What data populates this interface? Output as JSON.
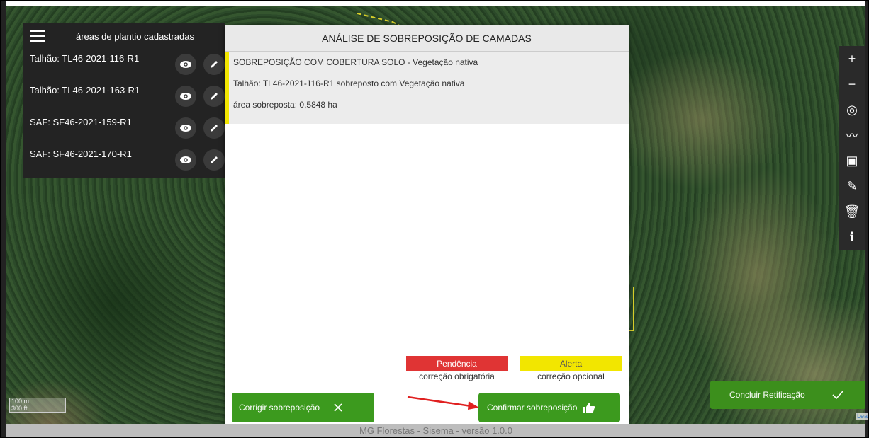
{
  "panel": {
    "title": "áreas de plantio cadastradas",
    "layers": [
      {
        "label": "Talhão: TL46-2021-116-R1"
      },
      {
        "label": "Talhão: TL46-2021-163-R1"
      },
      {
        "label": "SAF: SF46-2021-159-R1"
      },
      {
        "label": "SAF: SF46-2021-170-R1"
      }
    ],
    "icons": [
      "menu-icon",
      "eye-icon",
      "pencil-icon"
    ]
  },
  "modal": {
    "title": "ANÁLISE DE SOBREPOSIÇÃO DE CAMADAS",
    "overlap": {
      "heading": "SOBREPOSIÇÃO COM COBERTURA SOLO - Vegetação nativa",
      "description": "Talhão: TL46-2021-116-R1 sobreposto com Vegetação nativa",
      "area": "área sobreposta: 0,5848 ha",
      "severity_color": "#f2e600"
    },
    "legend": {
      "pendencia": {
        "label": "Pendência",
        "sub": "correção obrigatória",
        "color": "#e03434"
      },
      "alerta": {
        "label": "Alerta",
        "sub": "correção opcional",
        "color": "#f2e600"
      }
    },
    "buttons": {
      "corrigir": {
        "label": "Corrigir sobreposição",
        "icon": "close-icon"
      },
      "confirmar": {
        "label": "Confirmar sobreposição",
        "icon": "thumbs-up-icon"
      }
    }
  },
  "toolbar": {
    "tools": [
      {
        "name": "zoom-in-icon",
        "glyph": "+"
      },
      {
        "name": "zoom-out-icon",
        "glyph": "−"
      },
      {
        "name": "locate-icon",
        "glyph": "◎"
      },
      {
        "name": "measure-icon",
        "glyph": "〰"
      },
      {
        "name": "archive-icon",
        "glyph": "▣"
      },
      {
        "name": "pencil-icon",
        "glyph": "✎"
      },
      {
        "name": "trash-icon",
        "glyph": "🗑"
      },
      {
        "name": "info-icon",
        "glyph": "ℹ"
      }
    ]
  },
  "concluir": {
    "label": "Concluir Retificação",
    "icon": "check-icon"
  },
  "scale": {
    "metric": "100 m",
    "imperial": "300 ft"
  },
  "footer": "MG Florestas - Sisema - versão 1.0.0",
  "attribution": "Leaf",
  "colors": {
    "primary_green": "#3c9a1e",
    "panel_dark": "#232323",
    "annotation_arrow": "#e02020"
  }
}
